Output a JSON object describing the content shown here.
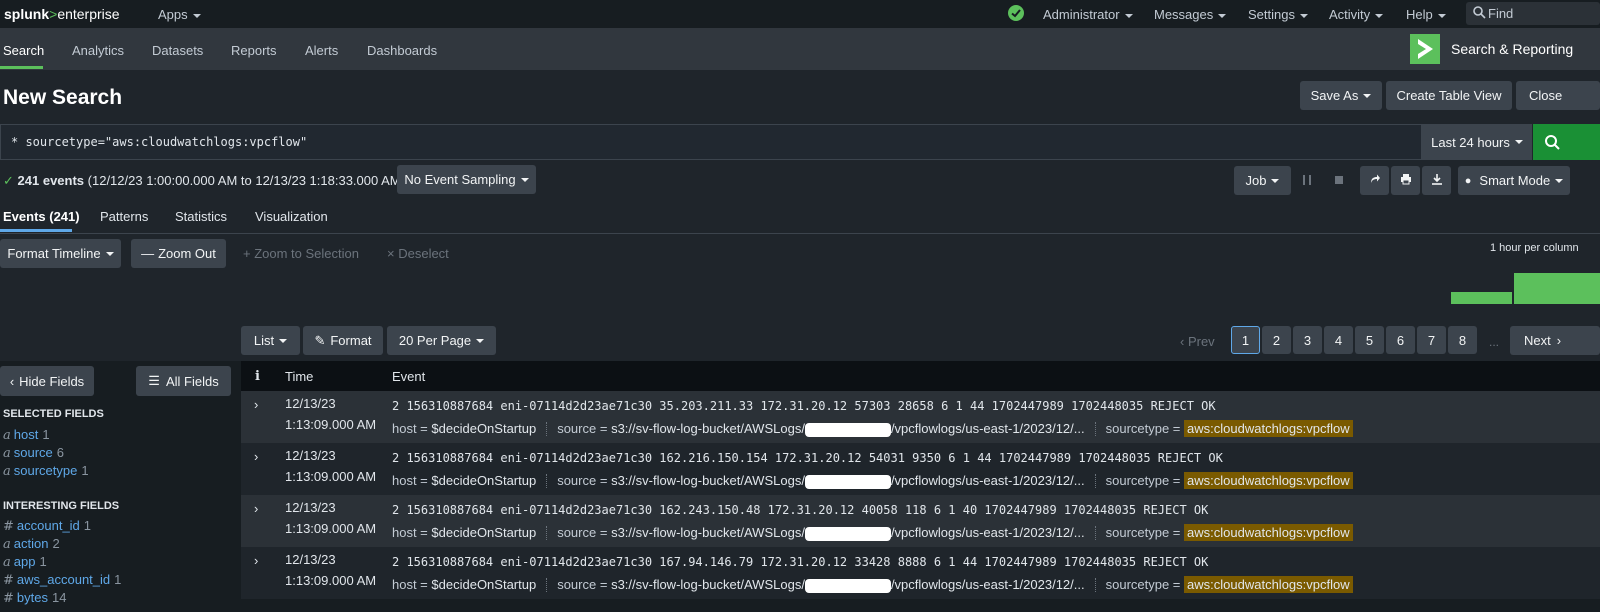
{
  "topbar": {
    "logo_left": "splunk",
    "logo_gt": ">",
    "logo_right": "enterprise",
    "apps": "Apps",
    "administrator": "Administrator",
    "messages": "Messages",
    "settings": "Settings",
    "activity": "Activity",
    "help": "Help",
    "find_placeholder": "Find",
    "status_icon": "check-circle-icon"
  },
  "appbar": {
    "tabs": [
      "Search",
      "Analytics",
      "Datasets",
      "Reports",
      "Alerts",
      "Dashboards"
    ],
    "app_title": "Search & Reporting"
  },
  "header": {
    "title": "New Search",
    "save_as": "Save As",
    "create_table_view": "Create Table View",
    "close": "Close"
  },
  "search": {
    "query": "* sourcetype=\"aws:cloudwatchlogs:vpcflow\"",
    "time_range": "Last 24 hours"
  },
  "status": {
    "count": "241 events",
    "range": "(12/12/23 1:00:00.000 AM to 12/13/23 1:18:33.000 AM)",
    "sampling": "No Event Sampling",
    "job": "Job",
    "mode": "Smart Mode"
  },
  "result_tabs": [
    "Events (241)",
    "Patterns",
    "Statistics",
    "Visualization"
  ],
  "timeline": {
    "format_timeline": "Format Timeline",
    "zoom_out": "Zoom Out",
    "zoom_selection": "Zoom to Selection",
    "deselect": "Deselect",
    "scale": "1 hour per column"
  },
  "list_controls": {
    "list": "List",
    "format": "Format",
    "per_page": "20 Per Page",
    "prev": "Prev",
    "pages": [
      "1",
      "2",
      "3",
      "4",
      "5",
      "6",
      "7",
      "8"
    ],
    "ellipsis": "...",
    "next": "Next"
  },
  "sidebar": {
    "hide_fields": "Hide Fields",
    "all_fields": "All Fields",
    "selected_title": "SELECTED FIELDS",
    "selected": [
      {
        "icon": "a",
        "name": "host",
        "count": "1"
      },
      {
        "icon": "a",
        "name": "source",
        "count": "6"
      },
      {
        "icon": "a",
        "name": "sourcetype",
        "count": "1"
      }
    ],
    "interesting_title": "INTERESTING FIELDS",
    "interesting": [
      {
        "icon": "#",
        "name": "account_id",
        "count": "1"
      },
      {
        "icon": "a",
        "name": "action",
        "count": "2"
      },
      {
        "icon": "a",
        "name": "app",
        "count": "1"
      },
      {
        "icon": "#",
        "name": "aws_account_id",
        "count": "1"
      },
      {
        "icon": "#",
        "name": "bytes",
        "count": "14"
      }
    ]
  },
  "table": {
    "col_info": "i",
    "col_time": "Time",
    "col_event": "Event",
    "rows": [
      {
        "date": "12/13/23",
        "time": "1:13:09.000 AM",
        "raw": "2 156310887684 eni-07114d2d23ae71c30 35.203.211.33 172.31.20.12 57303 28658 6 1 44 1702447989 1702448035 REJECT OK"
      },
      {
        "date": "12/13/23",
        "time": "1:13:09.000 AM",
        "raw": "2 156310887684 eni-07114d2d23ae71c30 162.216.150.154 172.31.20.12 54031 9350 6 1 44 1702447989 1702448035 REJECT OK"
      },
      {
        "date": "12/13/23",
        "time": "1:13:09.000 AM",
        "raw": "2 156310887684 eni-07114d2d23ae71c30 162.243.150.48 172.31.20.12 40058 118 6 1 40 1702447989 1702448035 REJECT OK"
      },
      {
        "date": "12/13/23",
        "time": "1:13:09.000 AM",
        "raw": "2 156310887684 eni-07114d2d23ae71c30 167.94.146.79 172.31.20.12 33428 8888 6 1 44 1702447989 1702448035 REJECT OK"
      }
    ],
    "meta": {
      "host_key": "host =",
      "host_val": "$decideOnStartup",
      "source_key": "source =",
      "source_prefix": "s3://sv-flow-log-bucket/AWSLogs/",
      "source_suffix": "/vpcflowlogs/us-east-1/2023/12/...",
      "sourcetype_key": "sourcetype =",
      "sourcetype_val": "aws:cloudwatchlogs:vpcflow"
    }
  },
  "colors": {
    "accent_green": "#5cc05c",
    "link_blue": "#5fa8e8",
    "highlight": "#7a5a00",
    "search_button": "#1a9035"
  }
}
